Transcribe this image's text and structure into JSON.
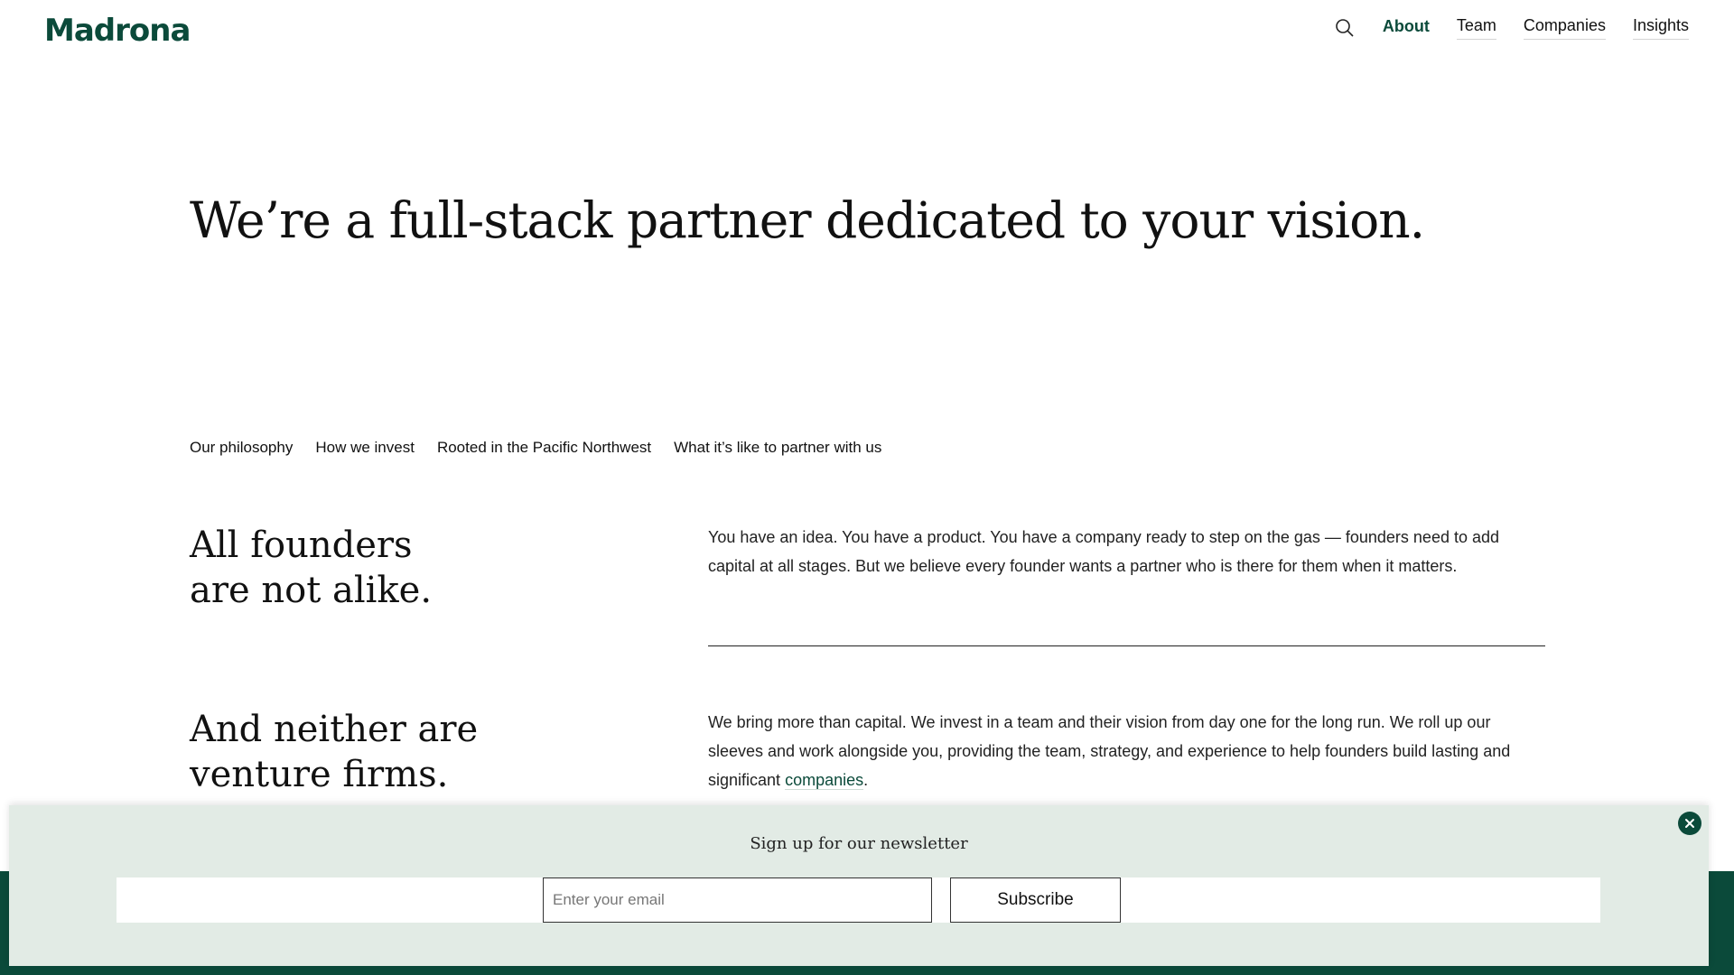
{
  "header": {
    "logo": "Madrona",
    "search_icon": "search-icon",
    "nav": [
      {
        "label": "About",
        "active": true
      },
      {
        "label": "Team",
        "active": false
      },
      {
        "label": "Companies",
        "active": false
      },
      {
        "label": "Insights",
        "active": false
      }
    ]
  },
  "hero": {
    "title": "We’re a full-stack partner dedicated to your vision."
  },
  "subnav": [
    {
      "label": "Our philosophy"
    },
    {
      "label": "How we invest"
    },
    {
      "label": "Rooted in the Pacific Northwest"
    },
    {
      "label": "What it’s like to partner with us"
    }
  ],
  "sections": [
    {
      "heading_line1": "All founders",
      "heading_line2": "are not alike.",
      "text": "You have an idea. You have a product. You have a company ready to step on the gas — founders need to add capital at all stages. But we believe every founder wants a partner who is there for them when it matters."
    },
    {
      "heading_line1": "And neither are",
      "heading_line2": "venture firms.",
      "text": "We bring more than capital. We invest in a team and their vision from day one for the long run. We roll up our sleeves and work alongside you, providing the team, strategy, and experience to help founders build lasting and significant",
      "link_text": "companies",
      "after_link": "."
    }
  ],
  "newsletter": {
    "title": "Sign up for our newsletter",
    "email_placeholder": "Enter your email",
    "email_value": "",
    "submit_label": "Subscribe",
    "close_icon": "close-icon"
  },
  "colors": {
    "brand": "#0b4a3a",
    "newsletter_bg": "#e2ebe5",
    "footer_bg": "#0b4a3a"
  }
}
